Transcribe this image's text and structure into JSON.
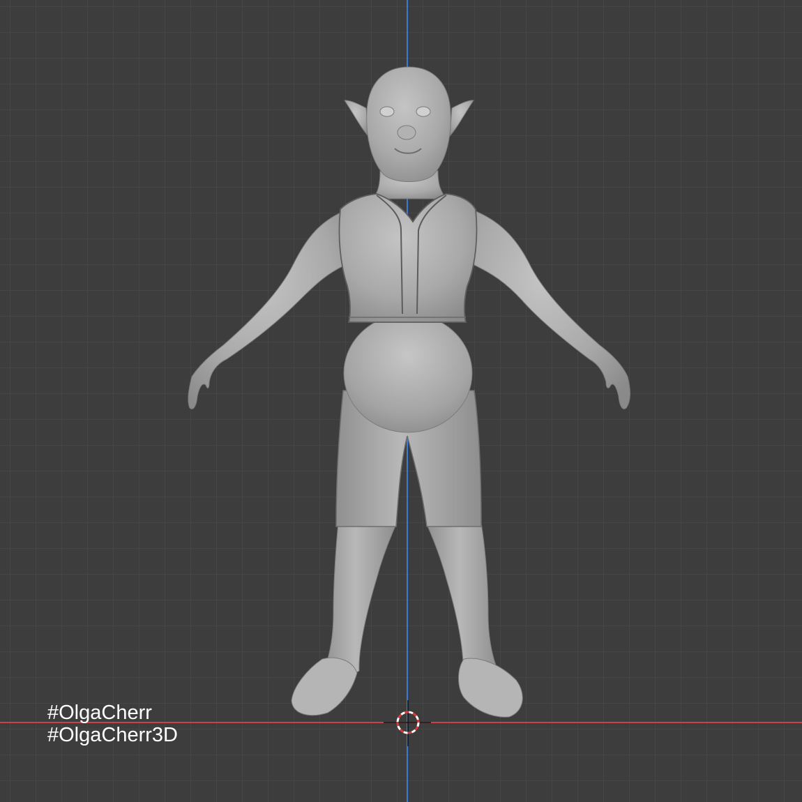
{
  "viewport": {
    "background_color": "#3d3d3d",
    "grid_color": "#464646",
    "axis_x_color": "#c9424a",
    "axis_z_color": "#3a7bd5",
    "model_color": "#a8a8a8"
  },
  "model": {
    "icon": "sculpted-goblin-character-model"
  },
  "cursor": {
    "icon": "3d-cursor-icon"
  },
  "watermark": {
    "line1": "#OlgaCherr",
    "line2": "#OlgaCherr3D"
  }
}
